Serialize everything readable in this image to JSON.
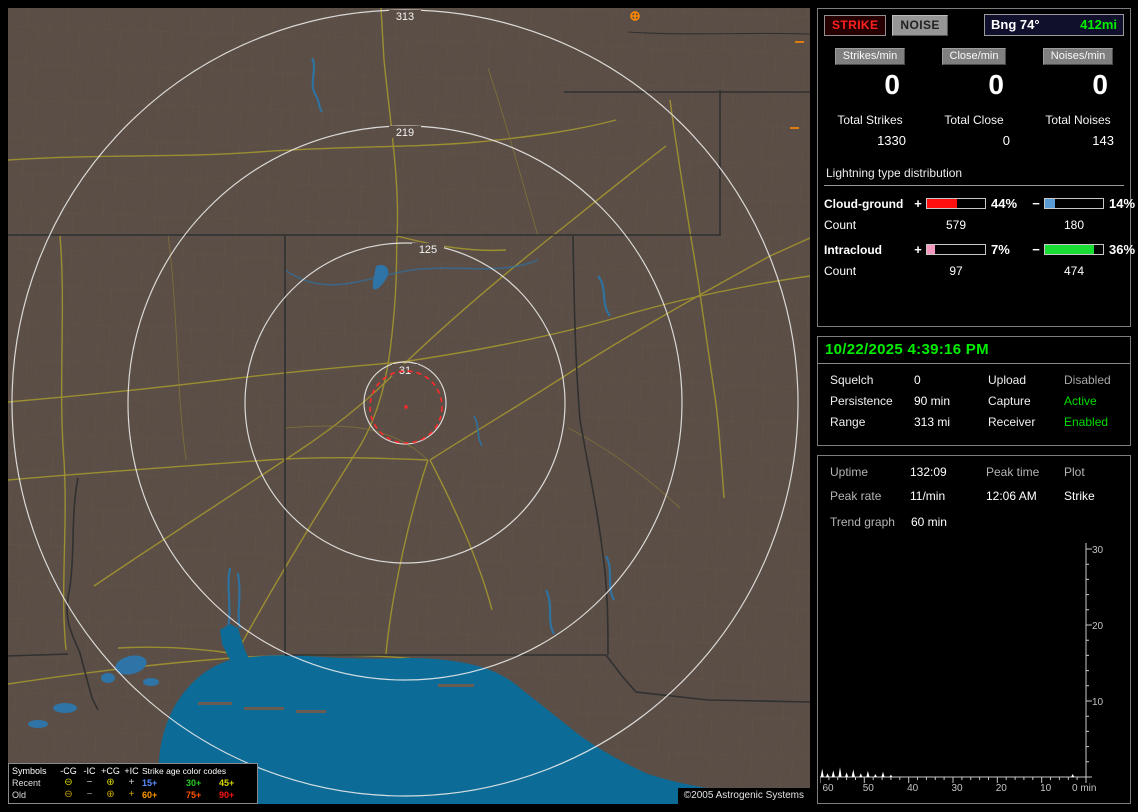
{
  "header": {
    "strike_label": "STRIKE",
    "noise_label": "NOISE",
    "bearing_label": "Bng 74°",
    "distance_label": "412mi",
    "distance_color": "#00ee00"
  },
  "rates": {
    "columns": [
      {
        "label": "Strikes/min",
        "value": "0",
        "total_label": "Total Strikes",
        "total_value": "1330"
      },
      {
        "label": "Close/min",
        "value": "0",
        "total_label": "Total Close",
        "total_value": "0"
      },
      {
        "label": "Noises/min",
        "value": "0",
        "total_label": "Total Noises",
        "total_value": "143"
      }
    ]
  },
  "distribution": {
    "title": "Lightning type distribution",
    "rows": [
      {
        "label": "Cloud-ground",
        "plus_sign": "+",
        "plus_pct_label": "44%",
        "plus_fill": 52,
        "plus_color": "#ff1010",
        "minus_sign": "−",
        "minus_pct_label": "14%",
        "minus_fill": 18,
        "minus_color": "#5b9bd5",
        "count_label": "Count",
        "plus_count": "579",
        "minus_count": "180"
      },
      {
        "label": "Intracloud",
        "plus_sign": "+",
        "plus_pct_label": "7%",
        "plus_fill": 13,
        "plus_color": "#f49ac1",
        "minus_sign": "−",
        "minus_pct_label": "36%",
        "minus_fill": 85,
        "minus_color": "#19dd35",
        "count_label": "Count",
        "plus_count": "97",
        "minus_count": "474"
      }
    ]
  },
  "status": {
    "datetime": "10/22/2025 4:39:16 PM",
    "datetime_color": "#00ee00",
    "rows": [
      {
        "label1": "Squelch",
        "value1": "0",
        "value1_color": "#ffffff",
        "label2": "Upload",
        "value2": "Disabled",
        "value2_color": "#a8a8a8"
      },
      {
        "label1": "Persistence",
        "value1": "90 min",
        "value1_color": "#ffffff",
        "label2": "Capture",
        "value2": "Active",
        "value2_color": "#00dd00"
      },
      {
        "label1": "Range",
        "value1": "313 mi",
        "value1_color": "#ffffff",
        "label2": "Receiver",
        "value2": "Enabled",
        "value2_color": "#00dd00"
      }
    ]
  },
  "stats": {
    "uptime_label": "Uptime",
    "uptime_value": "132:09",
    "peak_time_label": "Peak time",
    "peak_time_value": "12:06 AM",
    "plot_label": "Plot",
    "plot_value": "Strike",
    "peak_rate_label": "Peak rate",
    "peak_rate_value": "11/min",
    "trend_label": "Trend graph",
    "trend_value": "60 min"
  },
  "chart_data": {
    "type": "line",
    "title": "Strike rate trend (last 60 minutes)",
    "x_tick_labels": [
      "60",
      "50",
      "40",
      "30",
      "20",
      "10",
      "0 min"
    ],
    "y_tick_labels": [
      "30",
      "20",
      "10"
    ],
    "ylim": [
      0,
      30
    ],
    "xlim_minutes_ago": [
      60,
      0
    ],
    "grid": false,
    "legend": "none",
    "series": [
      {
        "name": "Strikes/min",
        "x_minutes_ago": [
          59.5,
          58.3,
          57,
          55.5,
          54,
          52.5,
          50.8,
          49.2,
          47.5,
          45.8,
          44,
          3
        ],
        "values": [
          1.1,
          0.5,
          0.9,
          1.3,
          0.6,
          1.0,
          0.5,
          0.8,
          0.4,
          0.7,
          0.3,
          0.4
        ]
      }
    ]
  },
  "map": {
    "ring_labels": [
      "313",
      "219",
      "125",
      "31"
    ],
    "copyright": "©2005 Astrogenic Systems",
    "legend": {
      "symbols_header": "Symbols",
      "col_headers": [
        "-CG",
        "-IC",
        "+CG",
        "+IC"
      ],
      "age_header": "Strike age color codes",
      "rows": [
        {
          "label": "Recent",
          "symbols": [
            {
              "glyph": "⊖",
              "color": "#d6d600"
            },
            {
              "glyph": "−",
              "color": "#cfcfcf"
            },
            {
              "glyph": "⊕",
              "color": "#d6d600"
            },
            {
              "glyph": "+",
              "color": "#cfcfcf"
            }
          ],
          "ages": [
            {
              "text": "15+",
              "color": "#5b8cff"
            },
            {
              "text": "30+",
              "color": "#22cc22"
            },
            {
              "text": "45+",
              "color": "#d6d600"
            }
          ]
        },
        {
          "label": "Old",
          "symbols": [
            {
              "glyph": "⊖",
              "color": "#c8a400"
            },
            {
              "glyph": "−",
              "color": "#9a9a9a"
            },
            {
              "glyph": "⊕",
              "color": "#c8a400"
            },
            {
              "glyph": "+",
              "color": "#c8a400"
            }
          ],
          "ages": [
            {
              "text": "60+",
              "color": "#ff9900"
            },
            {
              "text": "75+",
              "color": "#ff5500"
            },
            {
              "text": "90+",
              "color": "#ff1111"
            }
          ]
        }
      ]
    }
  }
}
